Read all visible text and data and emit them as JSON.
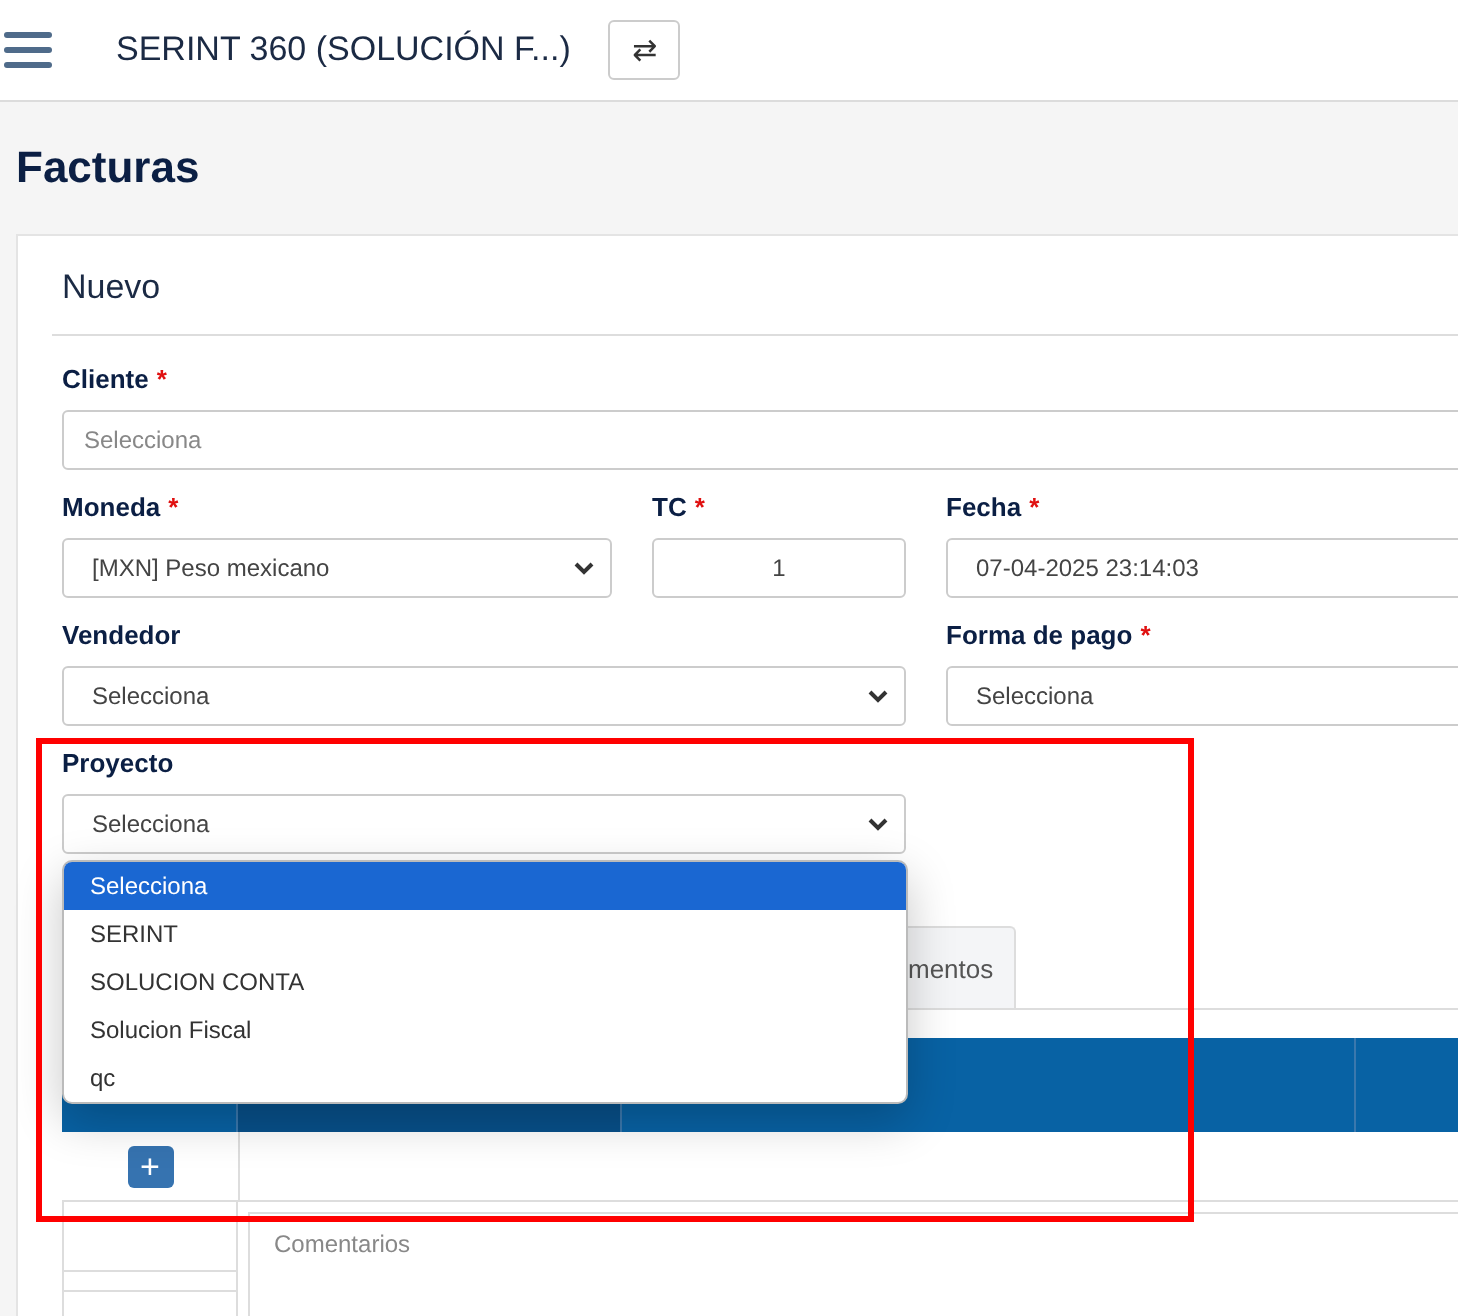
{
  "header": {
    "title": "SERINT 360 (SOLUCIÓN F...)",
    "swap_button": "⇄"
  },
  "page_title": "Facturas",
  "card_title": "Nuevo",
  "form_rows": [
    [
      {
        "label": "Cliente",
        "required_mark": "*",
        "kind": "text",
        "placeholder": "Selecciona"
      }
    ],
    [
      {
        "label": "Moneda",
        "required_mark": "*",
        "kind": "select",
        "value": "[MXN] Peso mexicano"
      },
      {
        "label": "TC",
        "required_mark": "*",
        "kind": "number",
        "value": "1"
      },
      {
        "label": "Fecha",
        "required_mark": "*",
        "kind": "plain",
        "value": "07-04-2025 23:14:03"
      }
    ],
    [
      {
        "label": "Vendedor",
        "kind": "select",
        "value": "Selecciona"
      },
      {
        "label": "Forma de pago",
        "required_mark": "*",
        "kind": "plain",
        "value": "Selecciona"
      }
    ],
    [
      {
        "label": "Proyecto",
        "kind": "select",
        "value": "Selecciona"
      }
    ]
  ],
  "dropdown": {
    "options": [
      {
        "label": "Selecciona",
        "selected": true
      },
      {
        "label": "SERINT",
        "selected": false
      },
      {
        "label": "SOLUCION CONTA",
        "selected": false
      },
      {
        "label": "Solucion Fiscal",
        "selected": false
      },
      {
        "label": "qc",
        "selected": false
      }
    ]
  },
  "tabs": [
    {
      "label": "mentos"
    }
  ],
  "table": {
    "add_button": "+",
    "comments": {
      "placeholder": "Comentarios"
    }
  }
}
